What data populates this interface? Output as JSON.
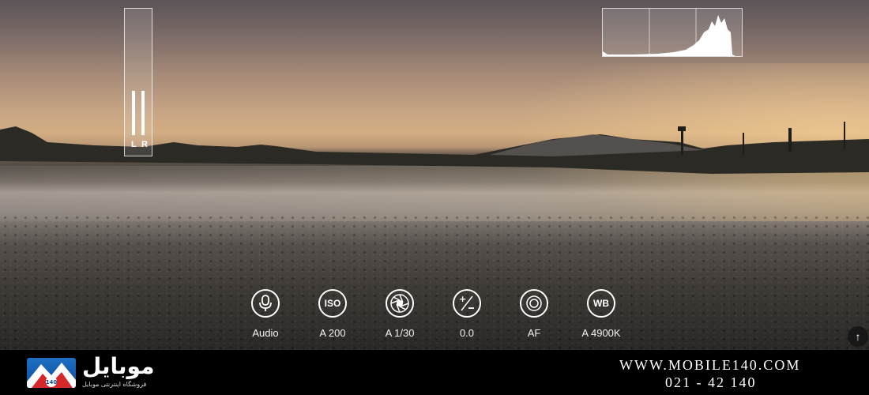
{
  "audio_meter": {
    "left_label": "L",
    "right_label": "R",
    "left_level": 0.36,
    "right_level": 0.36
  },
  "controls": [
    {
      "icon": "microphone-icon",
      "glyph": "",
      "label": "Audio"
    },
    {
      "icon": "iso-icon",
      "glyph": "ISO",
      "label": "A 200"
    },
    {
      "icon": "aperture-icon",
      "glyph": "",
      "label": "A 1/30"
    },
    {
      "icon": "exposure-compensation-icon",
      "glyph": "",
      "label": "0.0"
    },
    {
      "icon": "autofocus-icon",
      "glyph": "",
      "label": "AF"
    },
    {
      "icon": "white-balance-icon",
      "glyph": "WB",
      "label": "A 4900K"
    }
  ],
  "scroll_top": {
    "icon": "arrow-up-icon",
    "glyph": "↑"
  },
  "footer": {
    "brand": "موبایل",
    "brand_badge": "140",
    "tagline": "فروشگاه اینترنتی موبایل",
    "url": "WWW.MOBILE140.COM",
    "phone": "021 - 42 140"
  },
  "colors": {
    "accent": "#1e6fc4",
    "overlay_white": "#ffffff"
  }
}
